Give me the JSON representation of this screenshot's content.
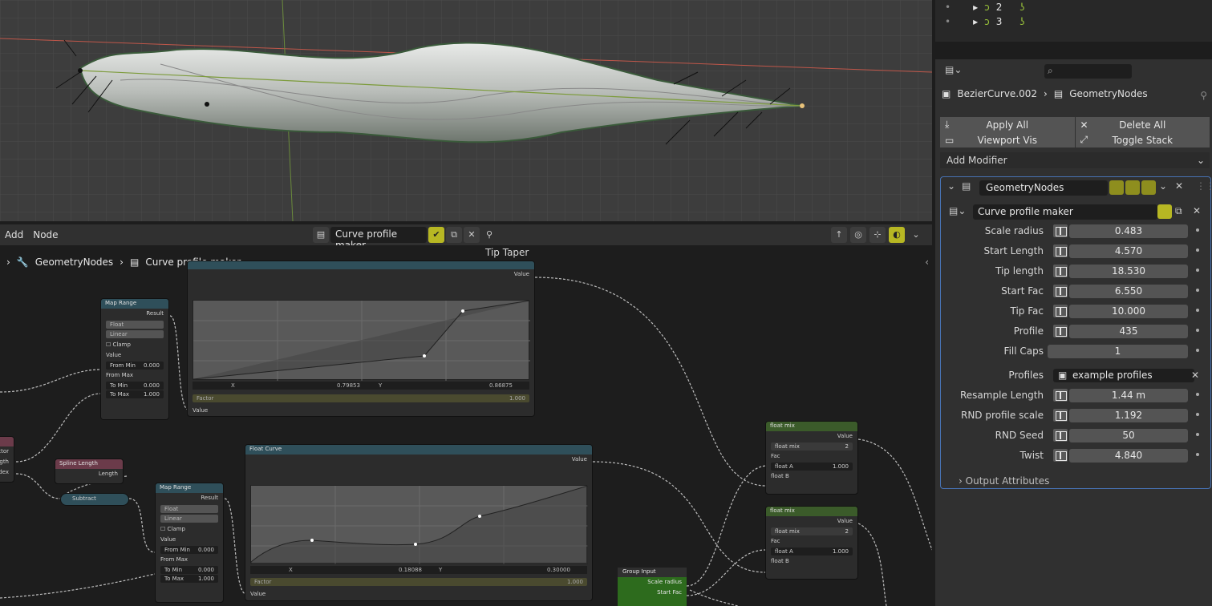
{
  "outliner": {
    "rows": [
      {
        "num": "2"
      },
      {
        "num": "3"
      }
    ]
  },
  "node_editor": {
    "menu": {
      "add": "Add",
      "node": "Node"
    },
    "tree_name": "Curve profile maker",
    "breadcrumb": {
      "modifier": "GeometryNodes",
      "group": "Curve profile maker"
    },
    "frame_label": "Tip Taper"
  },
  "nodes": {
    "map_range_1": {
      "title": "Map Range",
      "result": "Result",
      "type": "Float",
      "interp": "Linear",
      "clamp": "Clamp",
      "value": "Value",
      "from_min_lbl": "From Min",
      "from_min": "0.000",
      "from_max_lbl": "From Max",
      "to_min_lbl": "To Min",
      "to_min": "0.000",
      "to_max_lbl": "To Max",
      "to_max": "1.000"
    },
    "float_curve_1": {
      "value_out": "Value",
      "x_lbl": "X",
      "x": "0.79853",
      "y_lbl": "Y",
      "y": "0.86875",
      "factor": "Factor",
      "factor_val": "1.000",
      "value_in": "Value"
    },
    "spline_length": {
      "title": "Spline Length",
      "length": "Length"
    },
    "subtract": {
      "title": "Subtract"
    },
    "map_range_2": {
      "title": "Map Range",
      "result": "Result",
      "type": "Float",
      "interp": "Linear",
      "clamp": "Clamp",
      "value": "Value",
      "from_min_lbl": "From Min",
      "from_min": "0.000",
      "from_max_lbl": "From Max",
      "to_min_lbl": "To Min",
      "to_min": "0.000",
      "to_max_lbl": "To Max",
      "to_max": "1.000"
    },
    "float_curve_2": {
      "title": "Float Curve",
      "value_out": "Value",
      "x_lbl": "X",
      "x": "0.18088",
      "y_lbl": "Y",
      "y": "0.30000",
      "factor": "Factor",
      "factor_val": "1.000",
      "value_in": "Value"
    },
    "float_mix_1": {
      "title": "float mix",
      "value": "Value",
      "tree": "float mix",
      "users": "2",
      "fac": "Fac",
      "a_lbl": "float A",
      "a": "1.000",
      "b_lbl": "float B"
    },
    "float_mix_2": {
      "title": "float mix",
      "value": "Value",
      "tree": "float mix",
      "users": "2",
      "fac": "Fac",
      "a_lbl": "float A",
      "a": "1.000",
      "b_lbl": "float B"
    },
    "group_input": {
      "title": "Group Input",
      "scale": "Scale radius",
      "start": "Start Fac"
    },
    "left_partial": {
      "r1": "ctor",
      "r2": "ngth",
      "r3": "dex"
    }
  },
  "properties": {
    "breadcrumb": {
      "object": "BezierCurve.002",
      "modifier": "GeometryNodes"
    },
    "buttons": {
      "apply_all": "Apply All",
      "delete_all": "Delete All",
      "viewport_vis": "Viewport Vis",
      "toggle_stack": "Toggle Stack"
    },
    "add_modifier": "Add Modifier",
    "modifier_name": "GeometryNodes",
    "node_tree": "Curve profile maker",
    "inputs": [
      {
        "label": "Scale radius",
        "value": "0.483"
      },
      {
        "label": "Start Length",
        "value": "4.570"
      },
      {
        "label": "Tip length",
        "value": "18.530"
      },
      {
        "label": "Start Fac",
        "value": "6.550"
      },
      {
        "label": "Tip Fac",
        "value": "10.000"
      },
      {
        "label": "Profile",
        "value": "435"
      },
      {
        "label": "Fill Caps",
        "value": "1"
      },
      {
        "label": "Profiles",
        "value": "example profiles"
      },
      {
        "label": "Resample Length",
        "value": "1.44 m"
      },
      {
        "label": "RND profile scale",
        "value": "1.192"
      },
      {
        "label": "RND Seed",
        "value": "50"
      },
      {
        "label": "Twist",
        "value": "4.840"
      }
    ],
    "output_attributes": "Output Attributes"
  },
  "colors": {
    "accent_yellow": "#b7b723",
    "selection_blue": "#4772b3",
    "group_input_green": "#2d6b1d"
  }
}
